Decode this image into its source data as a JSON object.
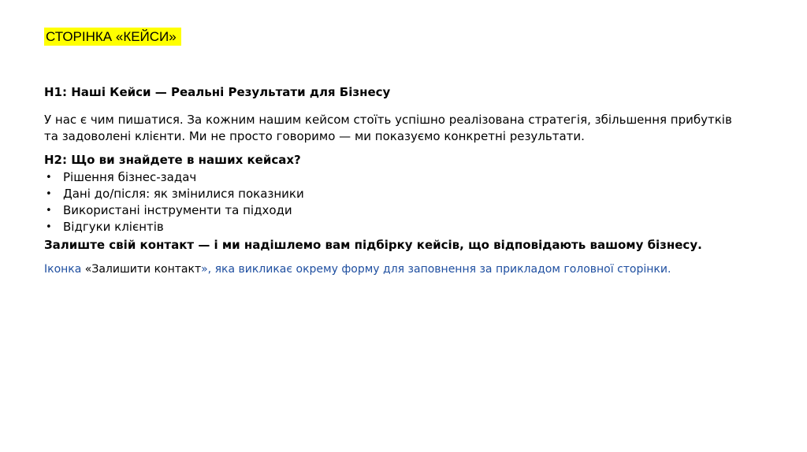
{
  "page_tag": "СТОРІНКА «КЕЙСИ»",
  "h1": "H1: Наші Кейси — Реальні Результати для Бізнесу",
  "intro": "У нас є чим пишатися. За кожним нашим кейсом стоїть успішно реалізована стратегія, збільшення прибутків та задоволені клієнти. Ми не просто говоримо — ми показуємо конкретні результати.",
  "h2": "H2: Що ви знайдете в наших кейсах?",
  "bullet_symbol": "•",
  "bullets": [
    "Рішення бізнес-задач",
    "Дані до/після: як змінилися показники",
    "Використані інструменти та підходи",
    "Відгуки клієнтів"
  ],
  "cta": "Залиште свій контакт — і ми надішлемо вам підбірку кейсів, що відповідають вашому бізнесу.",
  "note": {
    "prefix": "Іконка ",
    "quoted": "«Залишити контакт",
    "suffix": "», яка викликає окрему форму для заповнення за прикладом головної сторінки."
  },
  "colors": {
    "highlight": "#ffff00",
    "note_text": "#1f4fa0",
    "body_text": "#000000"
  }
}
